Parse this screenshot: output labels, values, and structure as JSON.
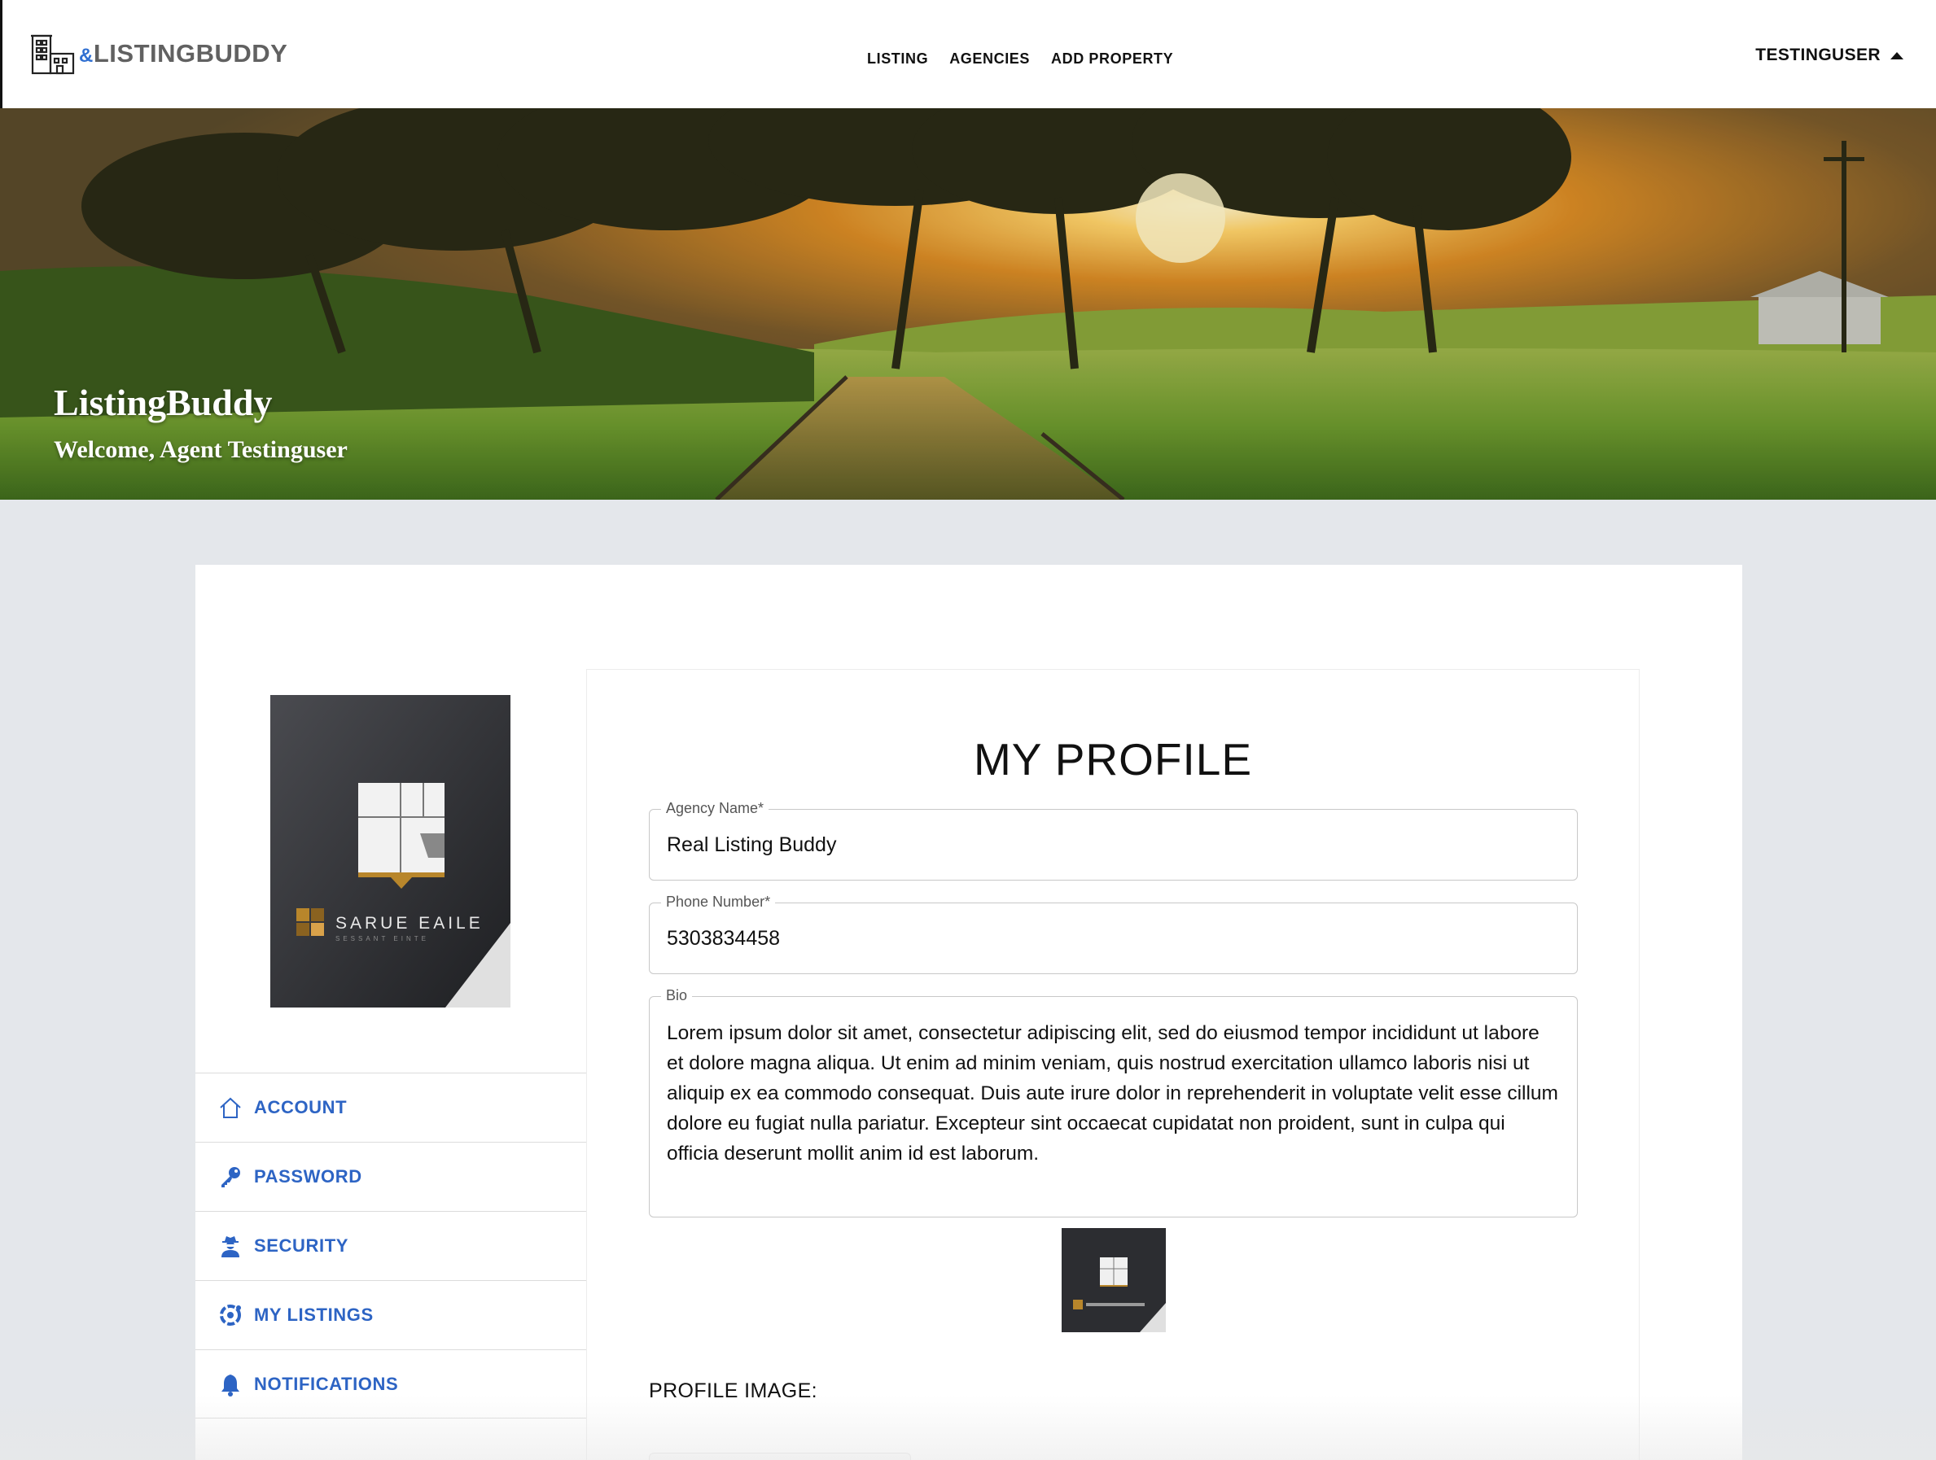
{
  "header": {
    "logo_amp": "&",
    "logo_text": "LISTINGBUDDY",
    "nav": [
      "LISTING",
      "AGENCIES",
      "ADD PROPERTY"
    ],
    "username": "TESTINGUSER"
  },
  "hero": {
    "title": "ListingBuddy",
    "subtitle": "Welcome,  Agent Testinguser"
  },
  "side_menu": [
    {
      "label": "ACCOUNT",
      "icon": "home-icon"
    },
    {
      "label": "PASSWORD",
      "icon": "key-icon"
    },
    {
      "label": "SECURITY",
      "icon": "user-secret-icon"
    },
    {
      "label": "MY LISTINGS",
      "icon": "listings-icon"
    },
    {
      "label": "NOTIFICATIONS",
      "icon": "bell-icon"
    }
  ],
  "profile": {
    "title": "MY PROFILE",
    "agency_label": "Agency Name*",
    "agency_value": "Real Listing Buddy",
    "phone_label": "Phone Number*",
    "phone_value": "5303834458",
    "bio_label": "Bio",
    "bio_value": "Lorem ipsum dolor sit amet, consectetur adipiscing elit, sed do eiusmod tempor incididunt ut labore et dolore magna aliqua. Ut enim ad minim veniam, quis nostrud exercitation ullamco laboris nisi ut aliquip ex ea commodo consequat. Duis aute irure dolor in reprehenderit in voluptate velit esse cillum dolore eu fugiat nulla pariatur. Excepteur sint occaecat cupidatat non proident, sunt in culpa qui officia deserunt mollit anim id est laborum.",
    "profile_image_label": "PROFILE IMAGE:"
  },
  "brand_logo": {
    "name": "SARUE EAILE",
    "tagline": "SESSANT EINTE"
  },
  "colors": {
    "accent": "#2d64c4",
    "logo_amp": "#2f6fd1",
    "page_bg": "#e4e7eb",
    "logo_gold": "#b8862b"
  }
}
